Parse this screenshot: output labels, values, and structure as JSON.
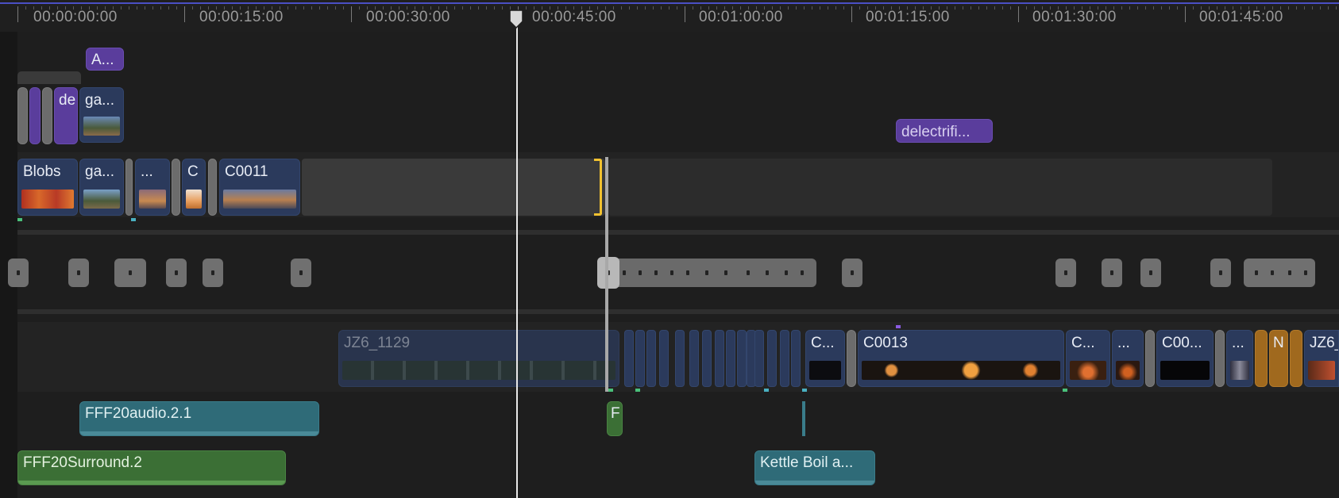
{
  "ruler": {
    "timecodes": [
      "00:00:00:00",
      "00:00:15:00",
      "00:00:30:00",
      "00:00:45:00",
      "00:01:00:00",
      "00:01:15:00",
      "00:01:30:00",
      "00:01:45:00"
    ]
  },
  "connected": {
    "title_a": "A...",
    "clip_de": "de",
    "clip_ga": "ga...",
    "title_delectrifi": "delectrifi..."
  },
  "primary": {
    "blobs": "Blobs",
    "ga": "ga...",
    "dots": "...",
    "c": "C",
    "c0011": "C0011"
  },
  "lower": {
    "jz6_1129": "JZ6_1129",
    "c1": "C...",
    "c0013": "C0013",
    "c2": "C...",
    "dots1": "...",
    "c00": "C00...",
    "dots2": "...",
    "n": "N",
    "jz6": "JZ6_"
  },
  "audio": {
    "fff20audio": "FFF20audio.2.1",
    "f": "F",
    "fff20surround": "FFF20Surround.2",
    "kettle": "Kettle Boil a..."
  },
  "colors": {
    "video_clip": "#2b3a5c",
    "title": "#5a3d9c",
    "audio_teal": "#2f6b78",
    "audio_green": "#3b6f35",
    "playhead": "#e8e8e8",
    "accent": "#4a4fc4",
    "range": "#f2c230"
  }
}
